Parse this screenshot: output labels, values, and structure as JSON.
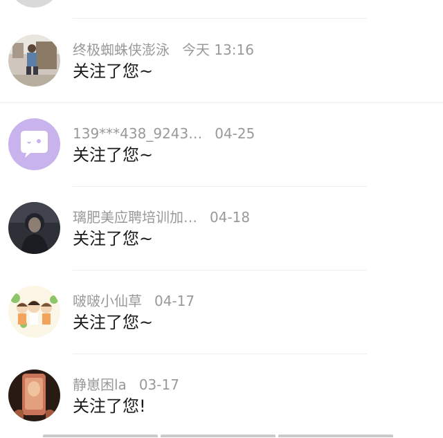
{
  "notifications": [
    {
      "name": "终极蜘蛛侠澎泳",
      "time": "今天 13:16",
      "message": "关注了您~"
    },
    {
      "name": "139***438_9243…",
      "time": "04-25",
      "message": "关注了您~"
    },
    {
      "name": "璃肥美应聘培训加…",
      "time": "04-18",
      "message": "关注了您~"
    },
    {
      "name": "啵啵小仙草",
      "time": "04-17",
      "message": "关注了您~"
    },
    {
      "name": "静崽困la",
      "time": "03-17",
      "message": "关注了您!"
    }
  ],
  "colors": {
    "name_text": "#999999",
    "message_text": "#1a1a1a",
    "divider": "#ededed",
    "chat_avatar_bg": "#c9b3ec"
  }
}
